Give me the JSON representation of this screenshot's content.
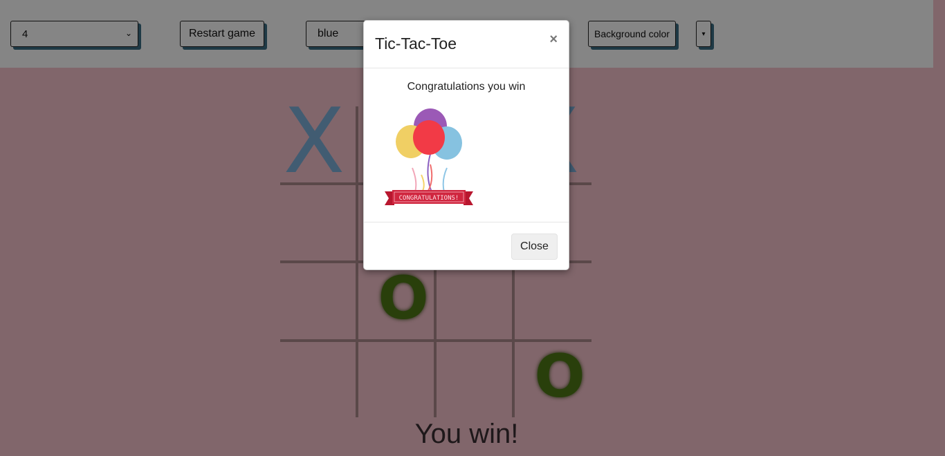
{
  "toolbar": {
    "board_size_value": "4",
    "restart_label": "Restart game",
    "color_value": "blue",
    "background_color_label": "Background color",
    "dropdown_caret": "▾"
  },
  "game": {
    "result_text": "You win!",
    "marks": [
      {
        "row": 0,
        "col": 0,
        "symbol": "X"
      },
      {
        "row": 0,
        "col": 3,
        "symbol": "X"
      },
      {
        "row": 2,
        "col": 1,
        "symbol": "O"
      },
      {
        "row": 3,
        "col": 3,
        "symbol": "O"
      }
    ]
  },
  "modal": {
    "title": "Tic-Tac-Toe",
    "close_x": "×",
    "message": "Congratulations you win",
    "banner_text": "CONGRATULATIONS!",
    "close_label": "Close"
  },
  "colors": {
    "page_bg": "#f7c3cd",
    "x_mark": "#7eb1da",
    "o_mark": "#4f7a16",
    "control_shadow": "#3d6f86",
    "banner": "#d0263f"
  }
}
